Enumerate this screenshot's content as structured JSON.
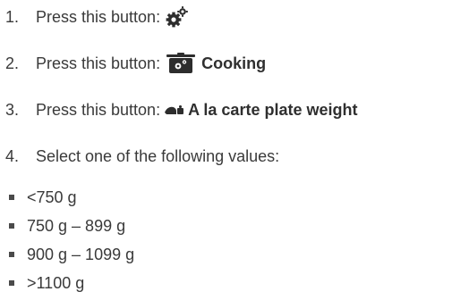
{
  "steps": [
    {
      "number": "1.",
      "text": "Press this button:",
      "icon": "settings-gears-icon",
      "label": ""
    },
    {
      "number": "2.",
      "text": "Press this button:",
      "icon": "cooking-pot-icon",
      "label": "Cooking"
    },
    {
      "number": "3.",
      "text": "Press this button:",
      "icon": "plate-weight-icon",
      "label": "A la carte plate weight"
    },
    {
      "number": "4.",
      "text": "Select one of the following values:",
      "icon": "",
      "label": ""
    }
  ],
  "values": [
    "<750 g",
    "750 g – 899 g",
    "900 g – 1099 g",
    ">1100 g"
  ],
  "colors": {
    "text": "#3a3a3a",
    "icon": "#2d2d2d",
    "bullet": "#4a4a4a"
  }
}
